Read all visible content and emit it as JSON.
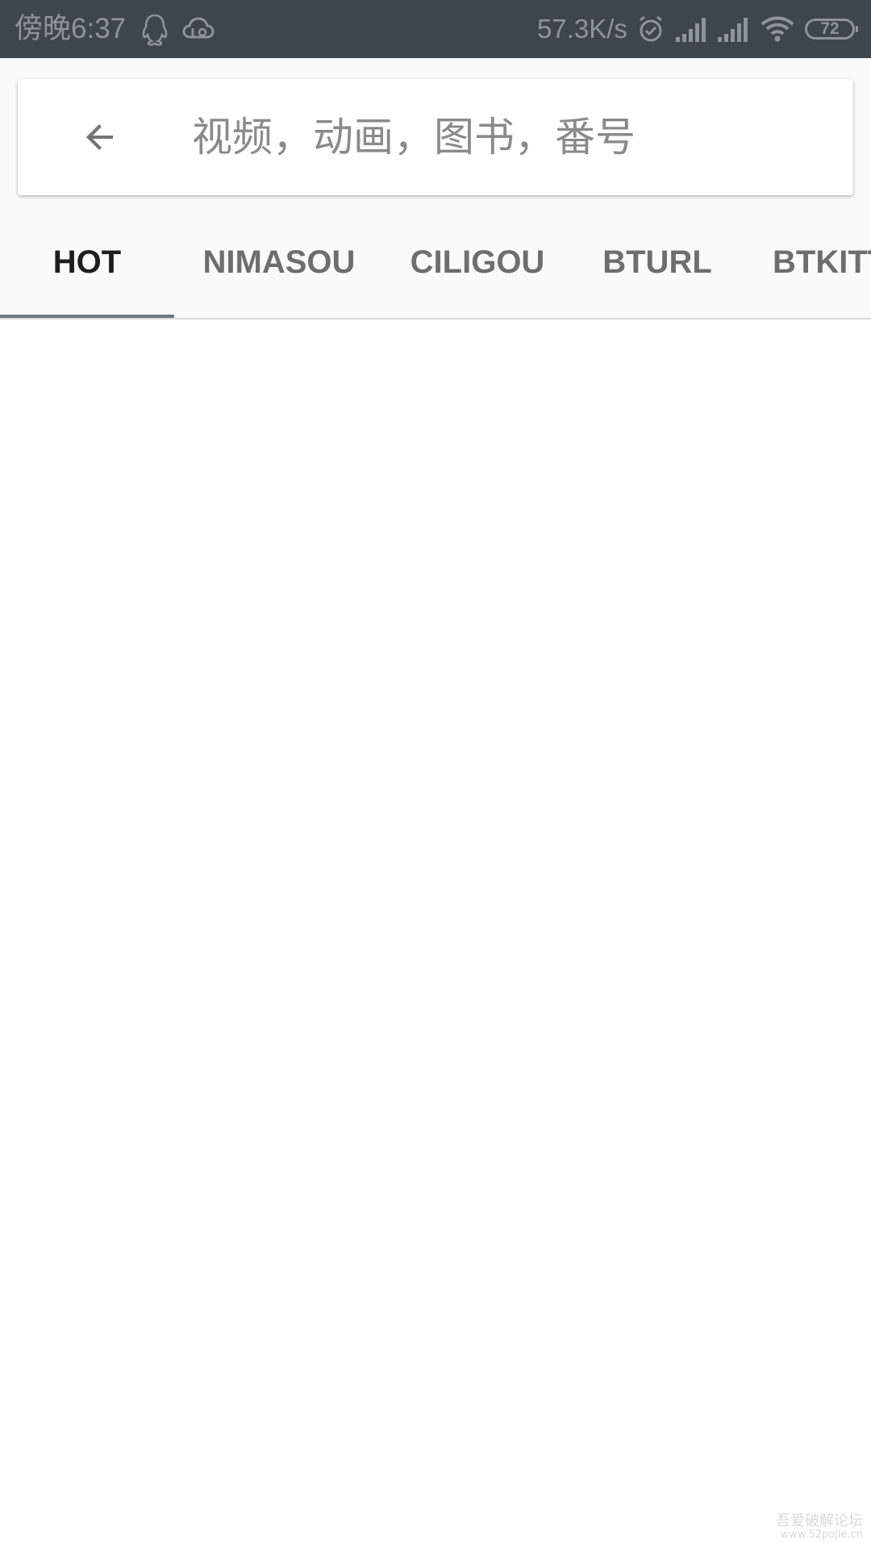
{
  "status_bar": {
    "time": "傍晚6:37",
    "speed": "57.3K/s",
    "battery": "72",
    "icons": [
      "qq-icon",
      "cloud-icon",
      "alarm-icon",
      "signal-icon",
      "signal-icon",
      "wifi-icon",
      "battery-icon"
    ]
  },
  "search": {
    "placeholder": "视频，动画，图书，番号",
    "value": ""
  },
  "tabs": [
    {
      "label": "HOT",
      "active": true
    },
    {
      "label": "NIMASOU",
      "active": false
    },
    {
      "label": "CILIGOU",
      "active": false
    },
    {
      "label": "BTURL",
      "active": false
    },
    {
      "label": "BTKITTY",
      "active": false
    }
  ],
  "watermark": {
    "line1": "吾爱破解论坛",
    "line2": "www.52pojie.cn"
  },
  "colors": {
    "status_bar_bg": "#3d454d",
    "header_bg": "#fafafa",
    "tab_indicator": "#6c7a85",
    "tab_active_text": "#1f1f1f",
    "tab_inactive_text": "#6e6e6e"
  }
}
